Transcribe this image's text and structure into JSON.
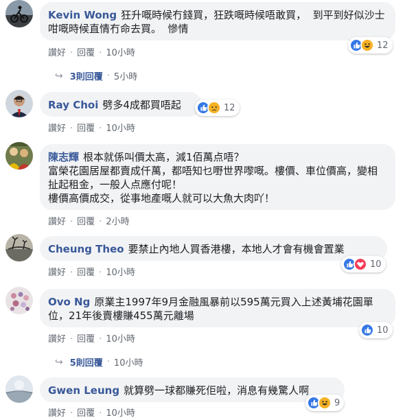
{
  "actions": {
    "like": "讚好",
    "reply": "回覆",
    "separator": "·"
  },
  "colors": {
    "like_blue": "#3578e5",
    "love_red": "#f33e58",
    "emoji_yellow": "#f7b125",
    "author_blue": "#385898"
  },
  "comments": [
    {
      "author": "Kevin Wong",
      "text": "狂升嘅時候冇錢買，狂跌嘅時候唔敢買，  到平到好似沙士咁嘅時候直情冇命去買。  慘情",
      "time": "10小時",
      "reactions": {
        "icons": [
          "like-icon",
          "haha-icon"
        ],
        "count": "12"
      },
      "replies": {
        "label": "3則回覆",
        "time": "5小時"
      }
    },
    {
      "author": "Ray Choi",
      "text": "劈多4成都買唔起",
      "time": "10小時",
      "reactions": {
        "icons": [
          "like-icon",
          "sad-icon"
        ],
        "count": "12"
      }
    },
    {
      "author": "陳志輝",
      "text": "根本就係叫價太高，減1佰萬点唔？\n富榮花園居屋都賣成仟萬，都唔知乜嘢世界嚟嘅。樓價、車位價高，變相扯起租金，一般人点應付呢！\n樓價高價成交，從事地產嘅人就可以大魚大肉吖！",
      "time": "2小時"
    },
    {
      "author": "Cheung Theo",
      "text": "要禁止內地人買香港樓，本地人才會有機會置業",
      "time": "10小時",
      "reactions": {
        "icons": [
          "like-icon",
          "love-icon"
        ],
        "count": "10"
      }
    },
    {
      "author": "Ovo Ng",
      "text": "原業主1997年9月金融風暴前以595萬元買入上述黃埔花園單位，21年後賣樓賺455萬元離場",
      "time": "10小時",
      "reactions": {
        "icons": [
          "like-icon"
        ],
        "count": "10"
      },
      "replies": {
        "label": "5則回覆",
        "time": "10小時"
      }
    },
    {
      "author": "Gwen Leung",
      "text": "就算劈一球都賺死佢啦，消息有幾驚人啊",
      "time": "10小時",
      "reactions": {
        "icons": [
          "like-icon",
          "haha-icon"
        ],
        "count": "9"
      }
    }
  ]
}
